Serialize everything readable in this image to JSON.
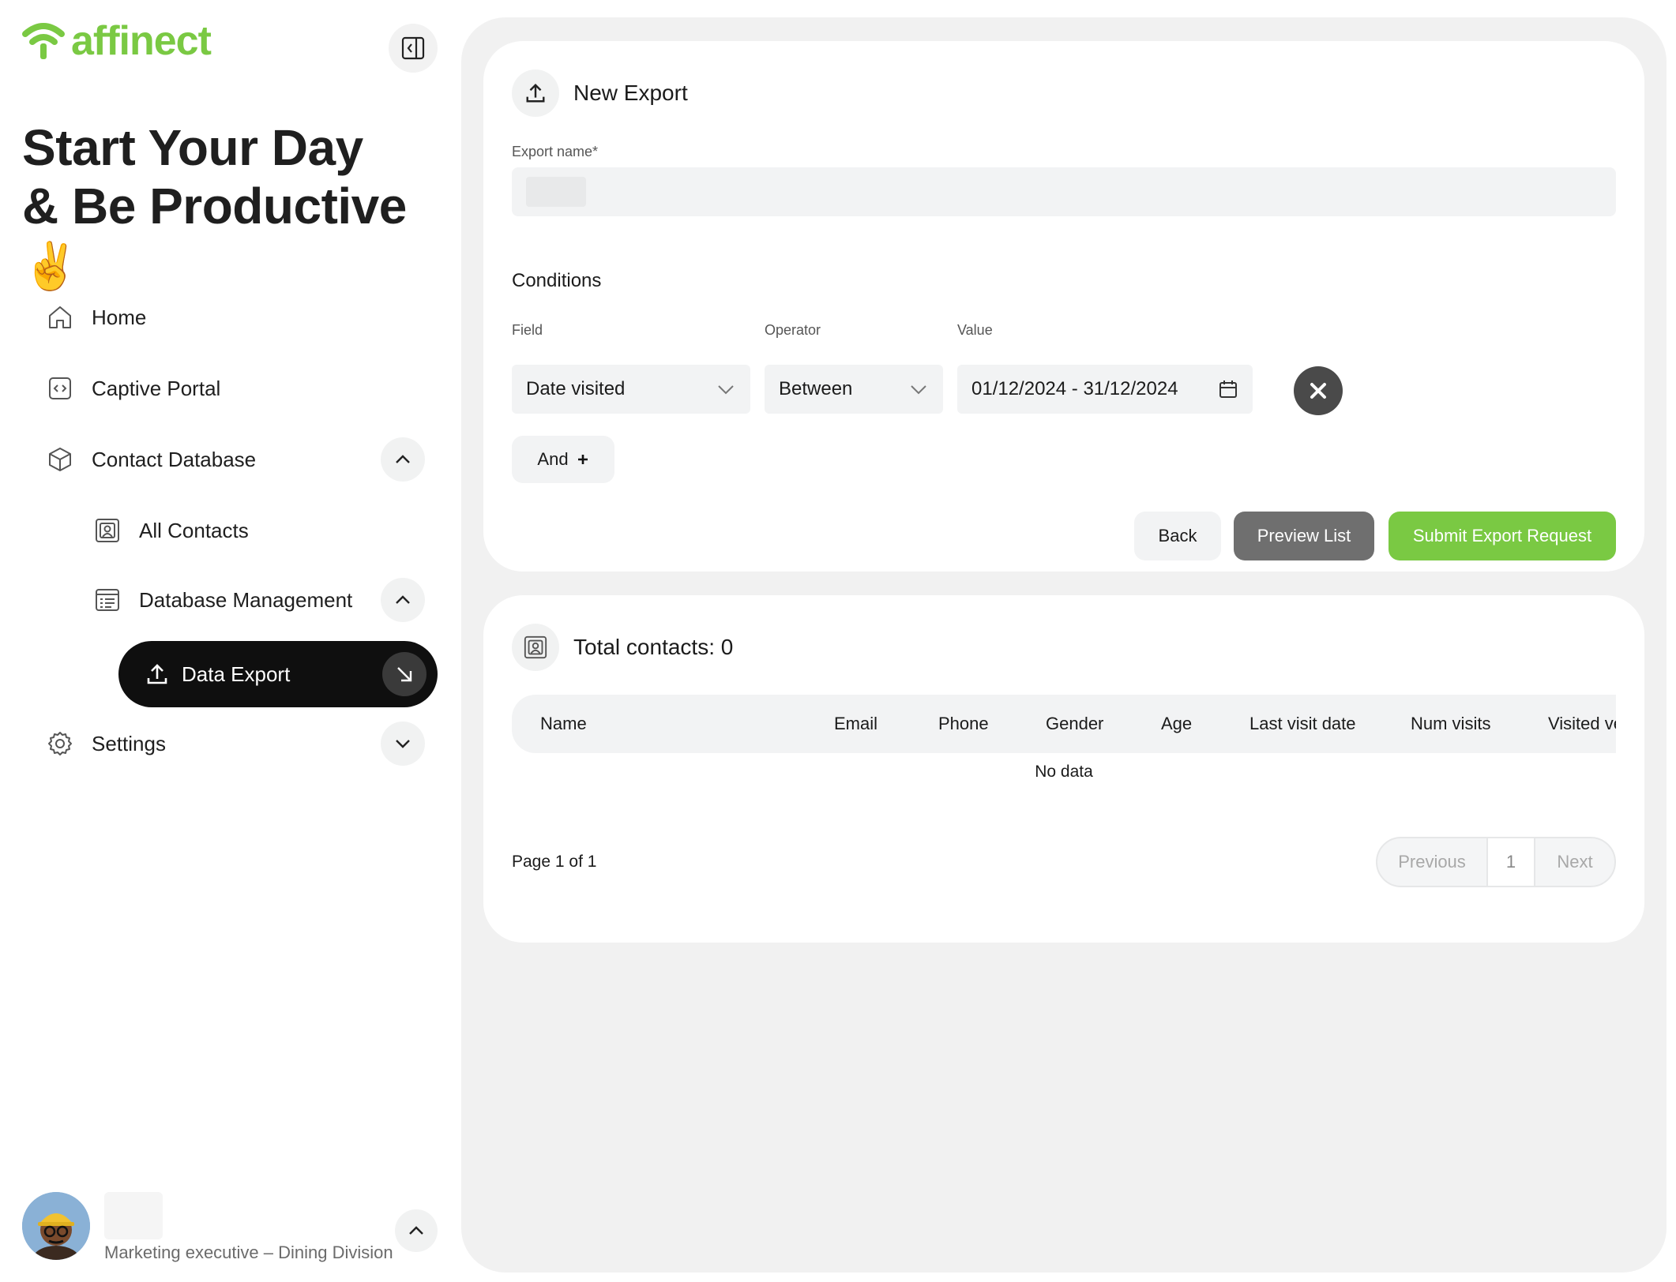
{
  "brand": {
    "name": "affinect",
    "color": "#7ac943"
  },
  "greeting": {
    "line1": "Start Your Day",
    "line2": "& Be Productive",
    "emoji": "✌️"
  },
  "nav": {
    "home": "Home",
    "captive_portal": "Captive Portal",
    "contact_database": "Contact Database",
    "all_contacts": "All Contacts",
    "database_management": "Database Management",
    "data_export": "Data Export",
    "settings": "Settings"
  },
  "user": {
    "role": "Marketing executive – Dining Division"
  },
  "export_form": {
    "title": "New Export",
    "export_name_label": "Export name*",
    "export_name_value": "",
    "conditions_title": "Conditions",
    "field_label": "Field",
    "operator_label": "Operator",
    "value_label": "Value",
    "field_value": "Date visited",
    "operator_value": "Between",
    "date_range": "01/12/2024 - 31/12/2024",
    "and_label": "And",
    "back_label": "Back",
    "preview_label": "Preview List",
    "submit_label": "Submit Export Request"
  },
  "results": {
    "title": "Total contacts: 0",
    "columns": [
      "Name",
      "Email",
      "Phone",
      "Gender",
      "Age",
      "Last visit date",
      "Num visits",
      "Visited ve"
    ],
    "empty_text": "No data",
    "page_info": "Page 1 of 1",
    "pager": {
      "previous": "Previous",
      "current": "1",
      "next": "Next"
    }
  },
  "colors": {
    "accent": "#7ac943",
    "active_nav": "#0f0f0f",
    "preview_button": "#6f6f6f"
  }
}
